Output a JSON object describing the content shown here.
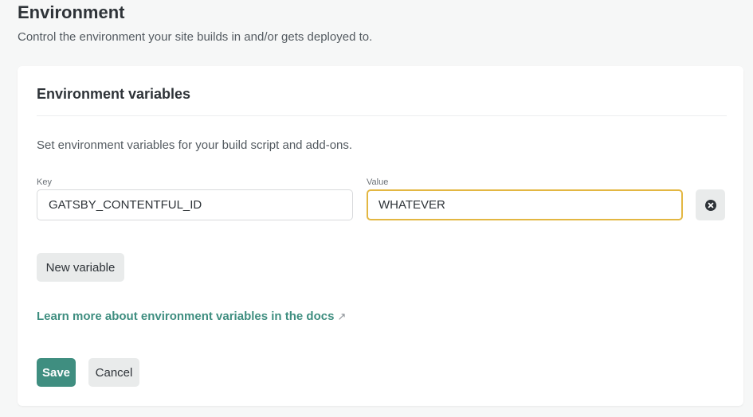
{
  "page": {
    "title": "Environment",
    "subtitle": "Control the environment your site builds in and/or gets deployed to."
  },
  "card": {
    "title": "Environment variables",
    "description": "Set environment variables for your build script and add-ons.",
    "variables": [
      {
        "key_label": "Key",
        "key_value": "GATSBY_CONTENTFUL_ID",
        "value_label": "Value",
        "value_value": "WHATEVER"
      }
    ],
    "delete_icon": "close-circle-icon",
    "new_variable_label": "New variable",
    "learn_more_label": "Learn more about environment variables in the docs",
    "learn_more_icon": "↗",
    "save_label": "Save",
    "cancel_label": "Cancel"
  },
  "colors": {
    "accent": "#3f8e80",
    "focus_border": "#e3b742",
    "background": "#f6f7f7"
  }
}
